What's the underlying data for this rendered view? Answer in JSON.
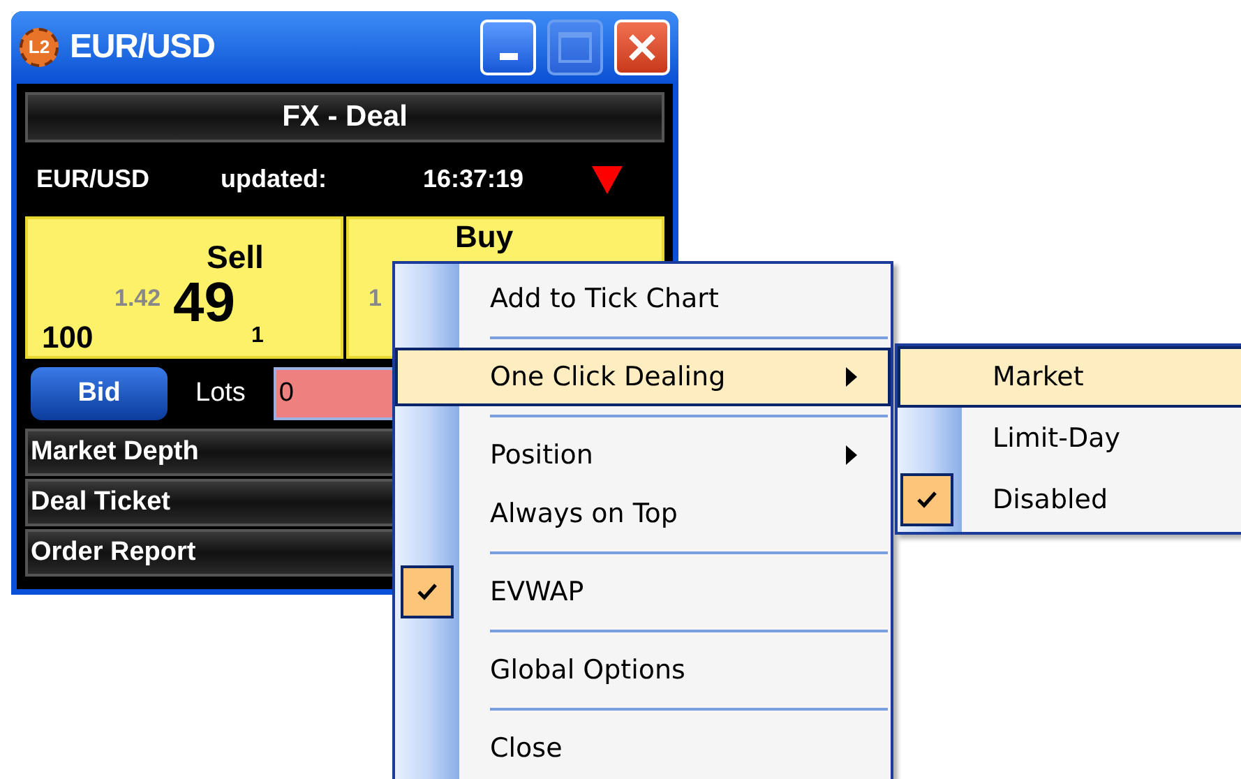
{
  "window": {
    "title": "EUR/USD",
    "icon_text": "L2"
  },
  "panel": {
    "title": "FX - Deal",
    "symbol": "EUR/USD",
    "updated_label": "updated:",
    "time": "16:37:19",
    "falling": true
  },
  "sell": {
    "label": "Sell",
    "size": "100",
    "prefix": "1.42",
    "big": "49",
    "sub": "1"
  },
  "buy": {
    "label": "Buy",
    "prefix_fragment": "1"
  },
  "controls": {
    "bid_button": "Bid",
    "lots_label": "Lots",
    "lots_value": "0"
  },
  "sections": [
    {
      "label": "Market Depth"
    },
    {
      "label": "Deal Ticket"
    },
    {
      "label": "Order Report"
    }
  ],
  "context_menu": [
    {
      "kind": "item",
      "label": "Add to Tick Chart",
      "selected": false,
      "checked": false,
      "submenu": false
    },
    {
      "kind": "separator"
    },
    {
      "kind": "item",
      "label": "One Click Dealing",
      "selected": true,
      "checked": false,
      "submenu": true
    },
    {
      "kind": "separator"
    },
    {
      "kind": "item",
      "label": "Position",
      "selected": false,
      "checked": false,
      "submenu": true
    },
    {
      "kind": "item",
      "label": "Always on Top",
      "selected": false,
      "checked": false,
      "submenu": false
    },
    {
      "kind": "separator"
    },
    {
      "kind": "item",
      "label": "EVWAP",
      "selected": false,
      "checked": true,
      "submenu": false
    },
    {
      "kind": "separator"
    },
    {
      "kind": "item",
      "label": "Global Options",
      "selected": false,
      "checked": false,
      "submenu": false
    },
    {
      "kind": "separator"
    },
    {
      "kind": "item",
      "label": "Close",
      "selected": false,
      "checked": false,
      "submenu": false
    }
  ],
  "submenu": [
    {
      "label": "Market",
      "selected": true,
      "checked": false
    },
    {
      "label": "Limit-Day",
      "selected": false,
      "checked": false
    },
    {
      "label": "Disabled",
      "selected": false,
      "checked": true
    }
  ]
}
